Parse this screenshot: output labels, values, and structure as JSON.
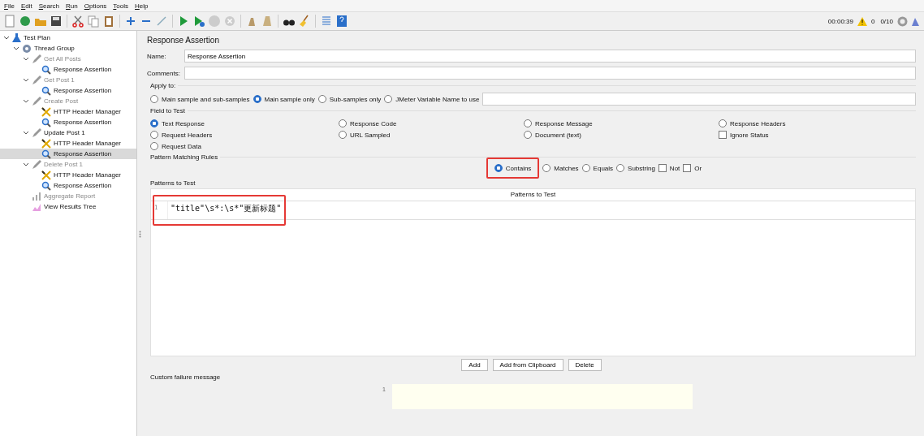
{
  "menu": [
    "File",
    "Edit",
    "Search",
    "Run",
    "Options",
    "Tools",
    "Help"
  ],
  "status": {
    "elapsed": "00:00:39",
    "warnings": "0",
    "threads": "0/10"
  },
  "tree": [
    {
      "label": "Test Plan",
      "kind": "plan",
      "disabled": false,
      "selected": false,
      "expanded": true,
      "children": [
        {
          "label": "Thread Group",
          "kind": "threads",
          "disabled": false,
          "selected": false,
          "expanded": true,
          "children": [
            {
              "label": "Get All Posts",
              "kind": "sampler",
              "disabled": true,
              "selected": false,
              "expanded": true,
              "children": [
                {
                  "label": "Response Assertion",
                  "kind": "assertion",
                  "disabled": false,
                  "selected": false
                }
              ]
            },
            {
              "label": "Get Post 1",
              "kind": "sampler",
              "disabled": true,
              "selected": false,
              "expanded": true,
              "children": [
                {
                  "label": "Response Assertion",
                  "kind": "assertion",
                  "disabled": false,
                  "selected": false
                }
              ]
            },
            {
              "label": "Create Post",
              "kind": "sampler",
              "disabled": true,
              "selected": false,
              "expanded": true,
              "children": [
                {
                  "label": "HTTP Header Manager",
                  "kind": "headers",
                  "disabled": false,
                  "selected": false
                },
                {
                  "label": "Response Assertion",
                  "kind": "assertion",
                  "disabled": false,
                  "selected": false
                }
              ]
            },
            {
              "label": "Update Post 1",
              "kind": "sampler",
              "disabled": false,
              "selected": false,
              "expanded": true,
              "children": [
                {
                  "label": "HTTP Header Manager",
                  "kind": "headers",
                  "disabled": false,
                  "selected": false
                },
                {
                  "label": "Response Assertion",
                  "kind": "assertion",
                  "disabled": false,
                  "selected": true
                }
              ]
            },
            {
              "label": "Delete Post 1",
              "kind": "sampler",
              "disabled": true,
              "selected": false,
              "expanded": true,
              "children": [
                {
                  "label": "HTTP Header Manager",
                  "kind": "headers",
                  "disabled": false,
                  "selected": false
                },
                {
                  "label": "Response Assertion",
                  "kind": "assertion",
                  "disabled": false,
                  "selected": false
                }
              ]
            },
            {
              "label": "Aggregate Report",
              "kind": "report",
              "disabled": true,
              "selected": false
            },
            {
              "label": "View Results Tree",
              "kind": "results",
              "disabled": false,
              "selected": false
            }
          ]
        }
      ]
    }
  ],
  "panel": {
    "title": "Response Assertion",
    "name": {
      "label": "Name:",
      "value": "Response Assertion"
    },
    "comments": {
      "label": "Comments:"
    },
    "apply_to": {
      "label": "Apply to:",
      "options": [
        {
          "label": "Main sample and sub-samples",
          "selected": false
        },
        {
          "label": "Main sample only",
          "selected": true
        },
        {
          "label": "Sub-samples only",
          "selected": false
        },
        {
          "label": "JMeter Variable Name to use",
          "selected": false
        }
      ]
    },
    "field_to_test": {
      "label": "Field to Test",
      "options": [
        {
          "label": "Text Response",
          "kind": "radio",
          "on": true
        },
        {
          "label": "Response Code",
          "kind": "radio",
          "on": false
        },
        {
          "label": "Response Message",
          "kind": "radio",
          "on": false
        },
        {
          "label": "Response Headers",
          "kind": "radio",
          "on": false
        },
        {
          "label": "Request Headers",
          "kind": "radio",
          "on": false
        },
        {
          "label": "URL Sampled",
          "kind": "radio",
          "on": false
        },
        {
          "label": "Document (text)",
          "kind": "radio",
          "on": false
        },
        {
          "label": "Ignore Status",
          "kind": "checkbox",
          "on": false
        },
        {
          "label": "Request Data",
          "kind": "radio",
          "on": false
        }
      ]
    },
    "pattern_rules": {
      "label": "Pattern Matching Rules",
      "options": [
        {
          "label": "Contains",
          "kind": "radio",
          "on": true,
          "highlighted": true
        },
        {
          "label": "Matches",
          "kind": "radio",
          "on": false,
          "highlighted": false
        },
        {
          "label": "Equals",
          "kind": "radio",
          "on": false,
          "highlighted": false
        },
        {
          "label": "Substring",
          "kind": "radio",
          "on": false,
          "highlighted": false
        },
        {
          "label": "Not",
          "kind": "checkbox",
          "on": false,
          "highlighted": false
        },
        {
          "label": "Or",
          "kind": "checkbox",
          "on": false,
          "highlighted": false
        }
      ]
    },
    "patterns": {
      "label": "Patterns to Test",
      "column": "Patterns to Test",
      "highlighted": true,
      "rows": [
        {
          "line": "1",
          "text": "\"title\"\\s*:\\s*\"更新标题\""
        }
      ]
    },
    "buttons": [
      "Add",
      "Add from Clipboard",
      "Delete"
    ],
    "failure": {
      "label": "Custom failure message",
      "line": "1"
    }
  }
}
